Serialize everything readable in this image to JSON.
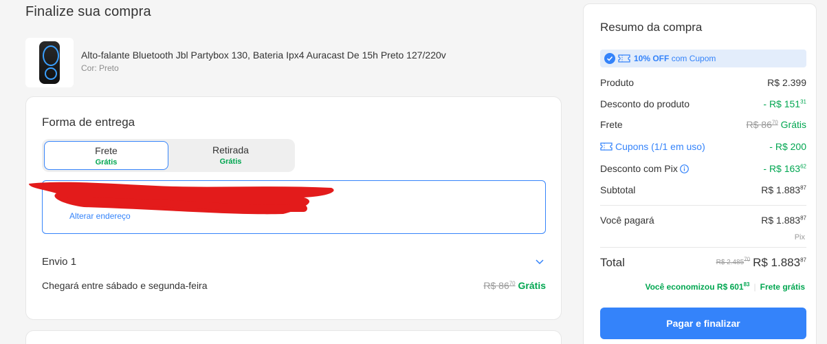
{
  "page": {
    "title": "Finalize sua compra"
  },
  "product": {
    "title": "Alto-falante Bluetooth Jbl Partybox 130, Bateria Ipx4 Auracast De 15h Preto 127/220v",
    "variant": "Cor: Preto"
  },
  "delivery": {
    "section_title": "Forma de entrega",
    "options": [
      {
        "label": "Frete",
        "sub": "Grátis"
      },
      {
        "label": "Retirada",
        "sub": "Grátis"
      }
    ],
    "address_link": "Alterar endereço",
    "shipment_title": "Envio 1",
    "arrival_text": "Chegará entre sábado e segunda-feira",
    "old_price": "R$ 86",
    "old_price_cents": "70",
    "free_label": "Grátis"
  },
  "summary": {
    "title": "Resumo da compra",
    "coupon_banner": {
      "highlight": "10% OFF",
      "text": "com Cupom"
    },
    "rows": {
      "produto": {
        "label": "Produto",
        "value": "R$ 2.399"
      },
      "desconto_produto": {
        "label": "Desconto do produto",
        "value": "- R$ 151",
        "cents": "31"
      },
      "frete": {
        "label": "Frete",
        "old": "R$ 86",
        "old_cents": "70",
        "value": "Grátis"
      },
      "cupons": {
        "label": "Cupons (1/1 em uso)",
        "value": "- R$ 200"
      },
      "desconto_pix": {
        "label": "Desconto com Pix",
        "value": "- R$ 163",
        "cents": "62"
      },
      "subtotal": {
        "label": "Subtotal",
        "value": "R$ 1.883",
        "cents": "87"
      },
      "voce_pagara": {
        "label": "Você pagará",
        "value": "R$ 1.883",
        "cents": "87",
        "method": "Pix"
      },
      "total": {
        "label": "Total",
        "old": "R$ 2.485",
        "old_cents": "70",
        "value": "R$ 1.883",
        "cents": "87"
      }
    },
    "savings": {
      "text": "Você economizou R$ 601",
      "cents": "83",
      "free_shipping": "Frete grátis"
    },
    "pay_button": "Pagar e finalizar"
  },
  "colors": {
    "accent": "#3483fa",
    "success": "#00a650",
    "muted": "#999999"
  },
  "icons": [
    "check-circle-icon",
    "ticket-icon",
    "info-icon",
    "chevron-down-icon"
  ]
}
